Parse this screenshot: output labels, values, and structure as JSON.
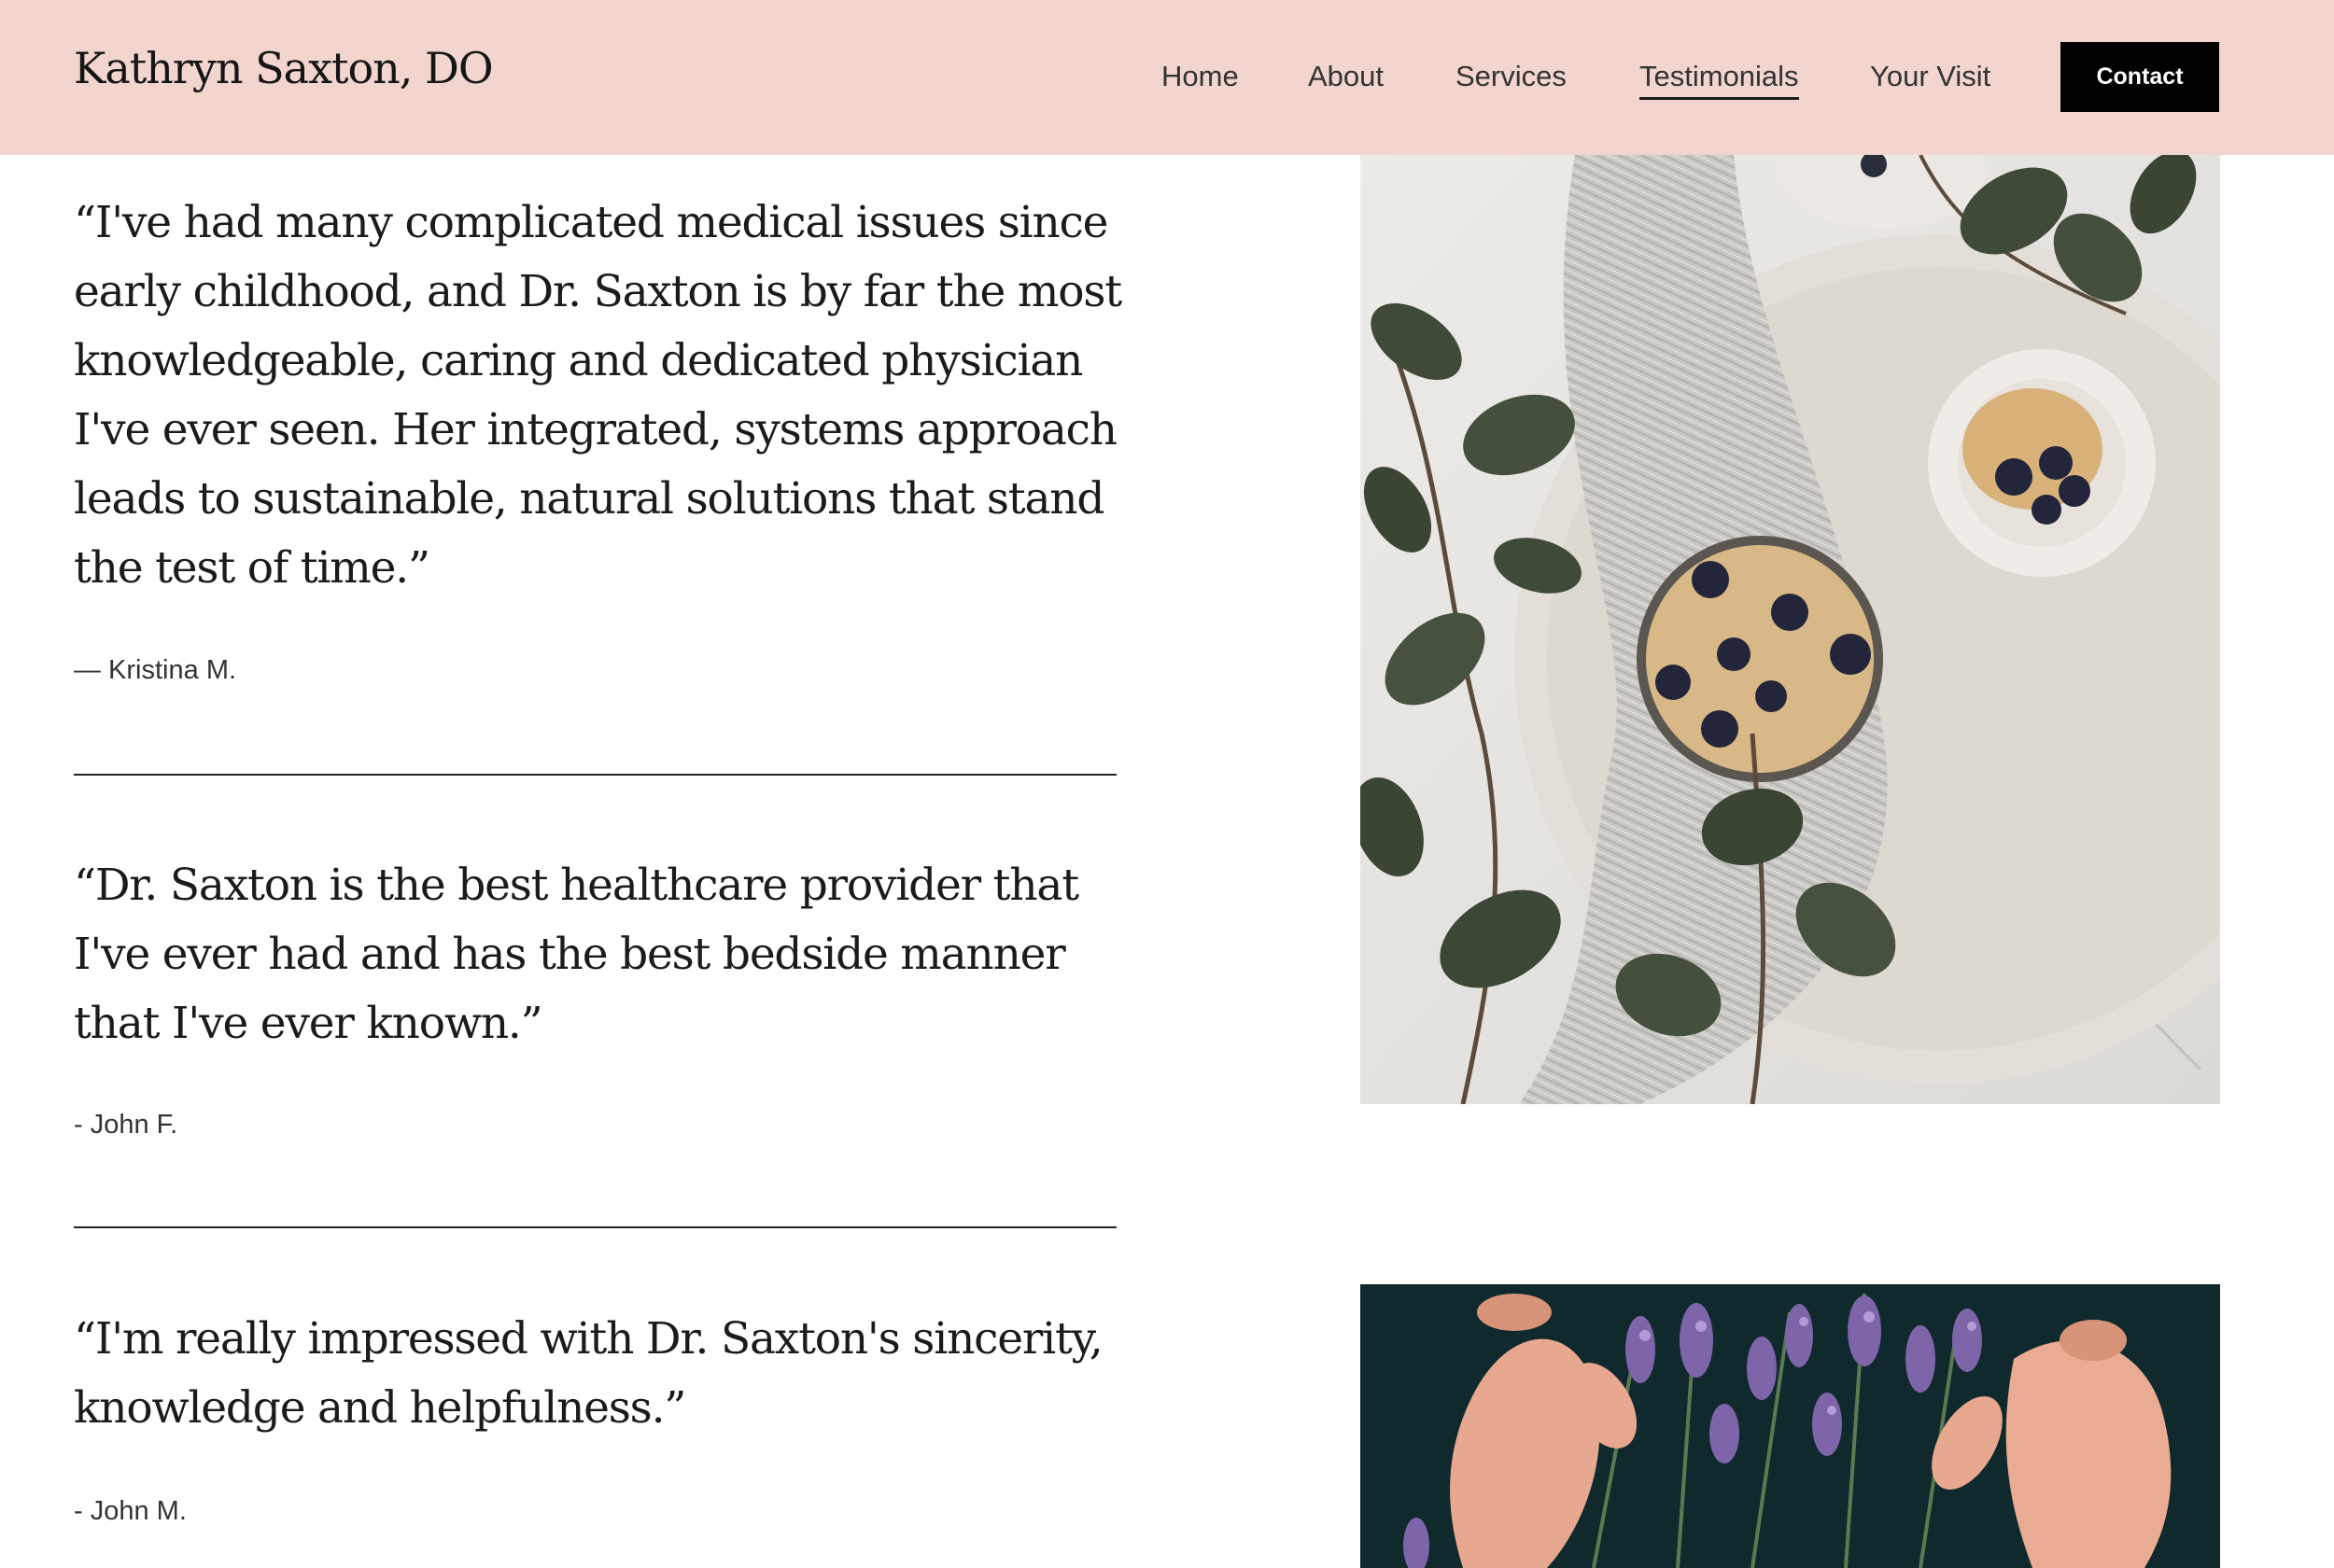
{
  "header": {
    "site_title": "Kathryn Saxton, DO",
    "nav": {
      "home": "Home",
      "about": "About",
      "services": "Services",
      "testimonials": "Testimonials",
      "your_visit": "Your Visit",
      "active": "Testimonials"
    },
    "contact_label": "Contact"
  },
  "testimonials": [
    {
      "quote": "“I've had many complicated medical issues since early childhood, and Dr. Saxton is by far the most knowledgeable, caring and dedicated physician I've ever seen. Her integrated, systems approach leads to sustainable, natural solutions that stand the test of time.”",
      "author": "— Kristina M."
    },
    {
      "quote": "“Dr. Saxton is the best healthcare provider that I've ever had and has the best bedside manner that I've ever known.”",
      "author": "- John F."
    },
    {
      "quote": "“I'm really impressed with Dr. Saxton's sincerity, knowledge and helpfulness.”",
      "author": "- John M."
    }
  ],
  "colors": {
    "header_bg": "#f1d5ce",
    "contact_bg": "#000000",
    "text": "#1b1b1b"
  }
}
